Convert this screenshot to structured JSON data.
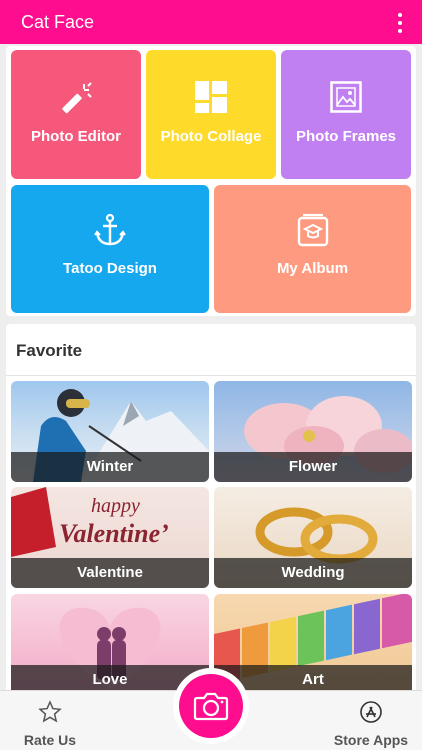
{
  "app": {
    "title": "Cat Face"
  },
  "icons": {
    "menu": "more-vert-icon",
    "photo_editor": "magic-wand-icon",
    "photo_collage": "collage-grid-icon",
    "photo_frames": "picture-frame-icon",
    "tattoo_design": "anchor-icon",
    "my_album": "album-icon",
    "rate_us": "star-outline-icon",
    "camera": "camera-icon",
    "store_apps": "app-store-icon"
  },
  "colors": {
    "brand": "#fe0e8e",
    "photo_editor": "#f6587c",
    "photo_collage": "#fedb2a",
    "photo_frames": "#c180f2",
    "tattoo_design": "#16a8ef",
    "my_album": "#fd9a7f"
  },
  "tools": {
    "photo_editor": "Photo Editor",
    "photo_collage": "Photo Collage",
    "photo_frames": "Photo Frames",
    "tattoo_design": "Tatoo Design",
    "my_album": "My Album"
  },
  "favorite": {
    "title": "Favorite",
    "items": [
      {
        "label": "Winter"
      },
      {
        "label": "Flower"
      },
      {
        "label": "Valentine",
        "art_text": "happy Valentine's"
      },
      {
        "label": "Wedding"
      },
      {
        "label": "Love"
      },
      {
        "label": "Art"
      }
    ]
  },
  "bottom_bar": {
    "rate_us": "Rate Us",
    "store_apps": "Store Apps"
  }
}
